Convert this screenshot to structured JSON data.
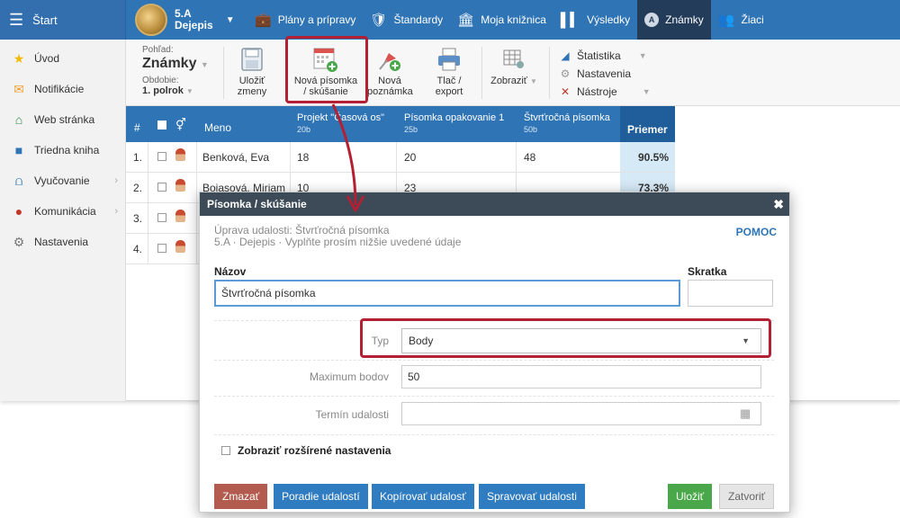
{
  "topbar": {
    "start_label": "Štart",
    "class_line1": "5.A",
    "class_line2": "Dejepis",
    "nav": [
      "Plány a prípravy",
      "Štandardy",
      "Moja knižnica",
      "Výsledky",
      "Známky",
      "Žiaci"
    ],
    "active_nav": "Známky",
    "accent": "#2f74b5",
    "active_bg": "#233c5a"
  },
  "sidebar": {
    "items": [
      {
        "label": "Úvod",
        "icon": "star-icon"
      },
      {
        "label": "Notifikácie",
        "icon": "envelope-icon"
      },
      {
        "label": "Web stránka",
        "icon": "home-icon"
      },
      {
        "label": "Triedna kniha",
        "icon": "book-icon"
      },
      {
        "label": "Vyučovanie",
        "icon": "bridge-icon"
      },
      {
        "label": "Komunikácia",
        "icon": "chat-icon"
      },
      {
        "label": "Nastavenia",
        "icon": "gear-icon"
      }
    ]
  },
  "toolbar": {
    "view_label": "Pohľad:",
    "view_value": "Známky",
    "period_label": "Obdobie:",
    "period_value": "1. polrok",
    "save_line1": "Uložiť",
    "save_line2": "zmeny",
    "new_test_line1": "Nová písomka",
    "new_test_line2": "/ skúšanie",
    "new_note_line1": "Nová",
    "new_note_line2": "poznámka",
    "print_line1": "Tlač /",
    "print_line2": "export",
    "show_label": "Zobraziť",
    "stats_label": "Štatistika",
    "settings_label": "Nastavenia",
    "tools_label": "Nástroje"
  },
  "table": {
    "headers": {
      "num": "#",
      "name": "Meno",
      "col1": "Projekt \"Časová os\"",
      "col1_sub": "20b",
      "col2": "Písomka opakovanie 1",
      "col2_sub": "25b",
      "col3": "Štvrťročná písomka",
      "col3_sub": "50b",
      "avg": "Priemer"
    },
    "rows": [
      {
        "num": "1.",
        "name": "Benková, Eva",
        "c1": "18",
        "c2": "20",
        "c3": "48",
        "avg": "90.5%"
      },
      {
        "num": "2.",
        "name": "Bojasová, Miriam",
        "c1": "10",
        "c2": "23",
        "c3": "",
        "avg": "73.3%"
      },
      {
        "num": "3.",
        "name": "",
        "c1": "",
        "c2": "",
        "c3": "",
        "avg": ""
      },
      {
        "num": "4.",
        "name": "",
        "c1": "",
        "c2": "",
        "c3": "",
        "avg": ""
      }
    ]
  },
  "dialog": {
    "title": "Písomka / skúšanie",
    "subtitle_line1": "Úprava udalosti: Štvrťročná písomka",
    "subtitle_line2": "5.A · Dejepis · Vyplňte prosím nižšie uvedené údaje",
    "help": "POMOC",
    "name_label": "Názov",
    "name_value": "Štvrťročná písomka",
    "abbr_label": "Skratka",
    "abbr_value": "",
    "type_label": "Typ",
    "type_value": "Body",
    "max_label": "Maximum bodov",
    "max_value": "50",
    "date_label": "Termín udalosti",
    "date_value": "",
    "advanced_label": "Zobraziť rozšírené nastavenia",
    "buttons": {
      "delete": "Zmazať",
      "order": "Poradie udalostí",
      "copy": "Kopírovať udalosť",
      "manage": "Spravovať udalosti",
      "save": "Uložiť",
      "close": "Zatvoriť"
    }
  },
  "annotation_color": "#b32033"
}
